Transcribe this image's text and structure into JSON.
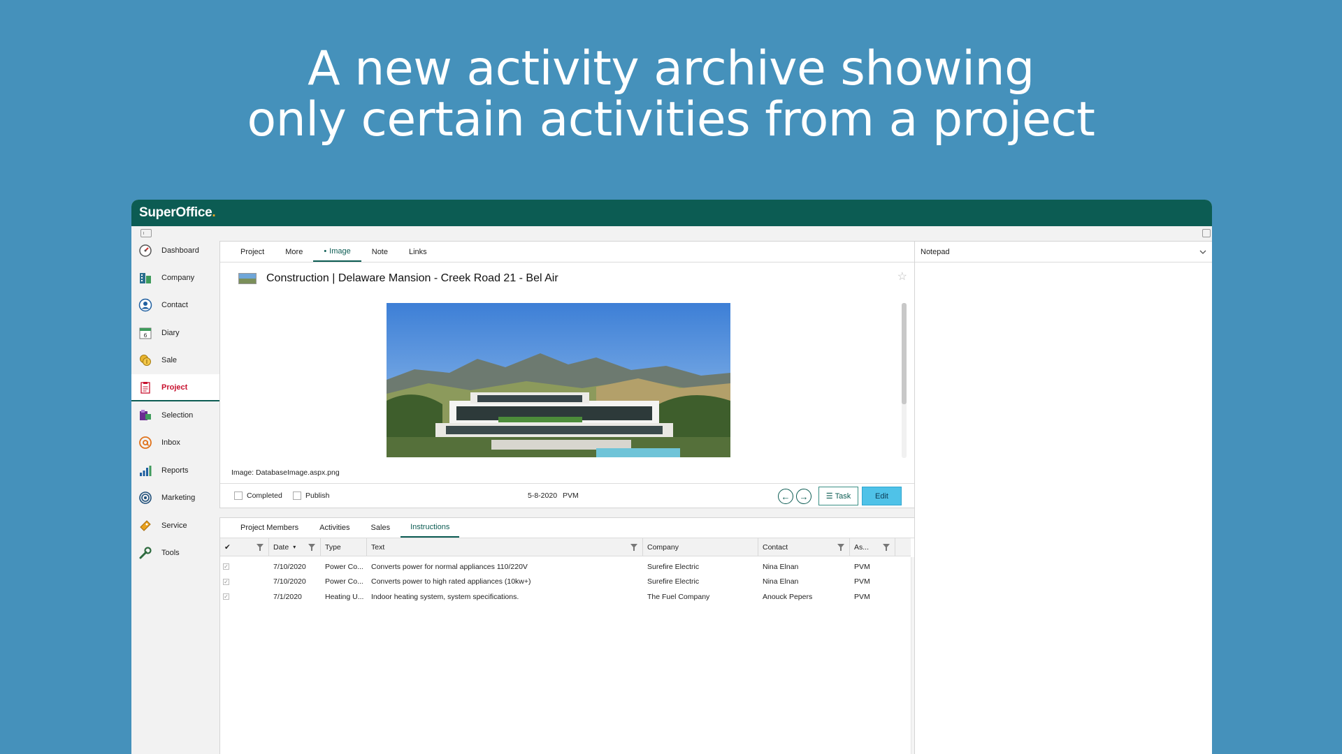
{
  "headline": {
    "line1": "A new activity archive showing",
    "line2": "only certain activities from a project"
  },
  "app": {
    "logo": "SuperOffice",
    "logo_dot": ".",
    "brand_color": "#0c5c53"
  },
  "sidebar": {
    "items": [
      {
        "label": "Dashboard",
        "icon": "speedometer-icon"
      },
      {
        "label": "Company",
        "icon": "building-icon"
      },
      {
        "label": "Contact",
        "icon": "person-icon"
      },
      {
        "label": "Diary",
        "icon": "calendar-icon",
        "day": "6"
      },
      {
        "label": "Sale",
        "icon": "coins-icon"
      },
      {
        "label": "Project",
        "icon": "clipboard-icon"
      },
      {
        "label": "Selection",
        "icon": "selection-icon"
      },
      {
        "label": "Inbox",
        "icon": "at-sign-icon"
      },
      {
        "label": "Reports",
        "icon": "bar-chart-icon"
      },
      {
        "label": "Marketing",
        "icon": "target-icon"
      },
      {
        "label": "Service",
        "icon": "ticket-icon"
      },
      {
        "label": "Tools",
        "icon": "wrench-icon"
      }
    ],
    "active": "Project"
  },
  "project_card": {
    "tabs": [
      "Project",
      "More",
      "Image",
      "Note",
      "Links"
    ],
    "active_tab": "Image",
    "active_marker": "•",
    "title": "Construction | Delaware Mansion - Creek Road 21 - Bel Air",
    "image_caption": "Image: DatabaseImage.aspx.png",
    "completed_label": "Completed",
    "publish_label": "Publish",
    "date": "5-8-2020",
    "owner": "PVM",
    "task_icon": "☰",
    "task_label": "Task",
    "edit_label": "Edit"
  },
  "activity_archive": {
    "tabs": [
      "Project Members",
      "Activities",
      "Sales",
      "Instructions"
    ],
    "active_tab": "Instructions",
    "columns": {
      "check": "✔",
      "date": "Date",
      "sort": "▾",
      "type": "Type",
      "text": "Text",
      "company": "Company",
      "contact": "Contact",
      "associate": "As..."
    },
    "rows": [
      {
        "date": "7/10/2020",
        "type": "Power Co...",
        "text": "Converts power for normal appliances 110/220V",
        "company": "Surefire Electric",
        "contact": "Nina Elnan",
        "associate": "PVM"
      },
      {
        "date": "7/10/2020",
        "type": "Power Co...",
        "text": "Converts power to high rated appliances (10kw+)",
        "company": "Surefire Electric",
        "contact": "Nina Elnan",
        "associate": "PVM"
      },
      {
        "date": "7/1/2020",
        "type": "Heating U...",
        "text": "Indoor heating system, system specifications.",
        "company": "The Fuel Company",
        "contact": "Anouck Pepers",
        "associate": "PVM"
      }
    ]
  },
  "notepad": {
    "label": "Notepad"
  }
}
